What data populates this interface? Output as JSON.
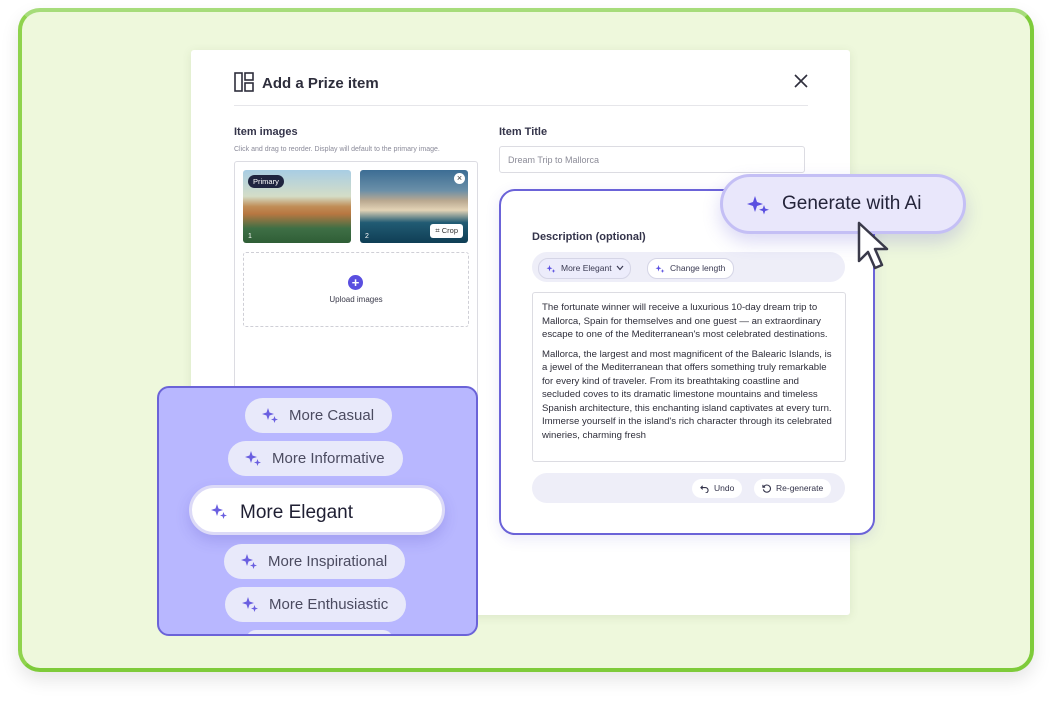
{
  "modal": {
    "title": "Add a Prize item",
    "layout_icon": "layout-icon",
    "close_icon": "close-icon"
  },
  "images": {
    "label": "Item images",
    "hint": "Click and drag to reorder. Display will default to the primary image.",
    "items": [
      {
        "badge": "Primary",
        "index": "1"
      },
      {
        "index": "2",
        "crop_label": "Crop",
        "remove_icon": "close-icon"
      }
    ],
    "upload_label": "Upload images"
  },
  "title_field": {
    "label": "Item Title",
    "value": "Dream Trip to Mallorca"
  },
  "description": {
    "label": "Description  (optional)",
    "tone_chip": "More Elegant",
    "length_chip": "Change length",
    "paragraphs": [
      "The fortunate winner will receive a luxurious 10-day dream trip to Mallorca, Spain for themselves and one guest — an extraordinary escape to one of the Mediterranean's most celebrated destinations.",
      "Mallorca, the largest and most magnificent of the Balearic Islands, is a jewel of the Mediterranean that offers something truly remarkable for every kind of traveler. From its breathtaking coastline and secluded coves to its dramatic limestone mountains and timeless Spanish architecture, this enchanting island captivates at every turn. Immerse yourself in the island's rich character through its celebrated wineries, charming fresh"
    ],
    "undo_label": "Undo",
    "regenerate_label": "Re-generate"
  },
  "generate_button": {
    "label": "Generate with Ai",
    "icon": "sparkle-icon"
  },
  "tone_menu": {
    "options": [
      "More Casual",
      "More Informative",
      "More Elegant",
      "More Inspirational",
      "More Enthusiastic"
    ],
    "selected": "More Elegant"
  },
  "colors": {
    "accent": "#5a4fe0",
    "frame_border": "#7ecb3a",
    "frame_fill": "#eef8dc",
    "panel": "#b8b7ff"
  }
}
